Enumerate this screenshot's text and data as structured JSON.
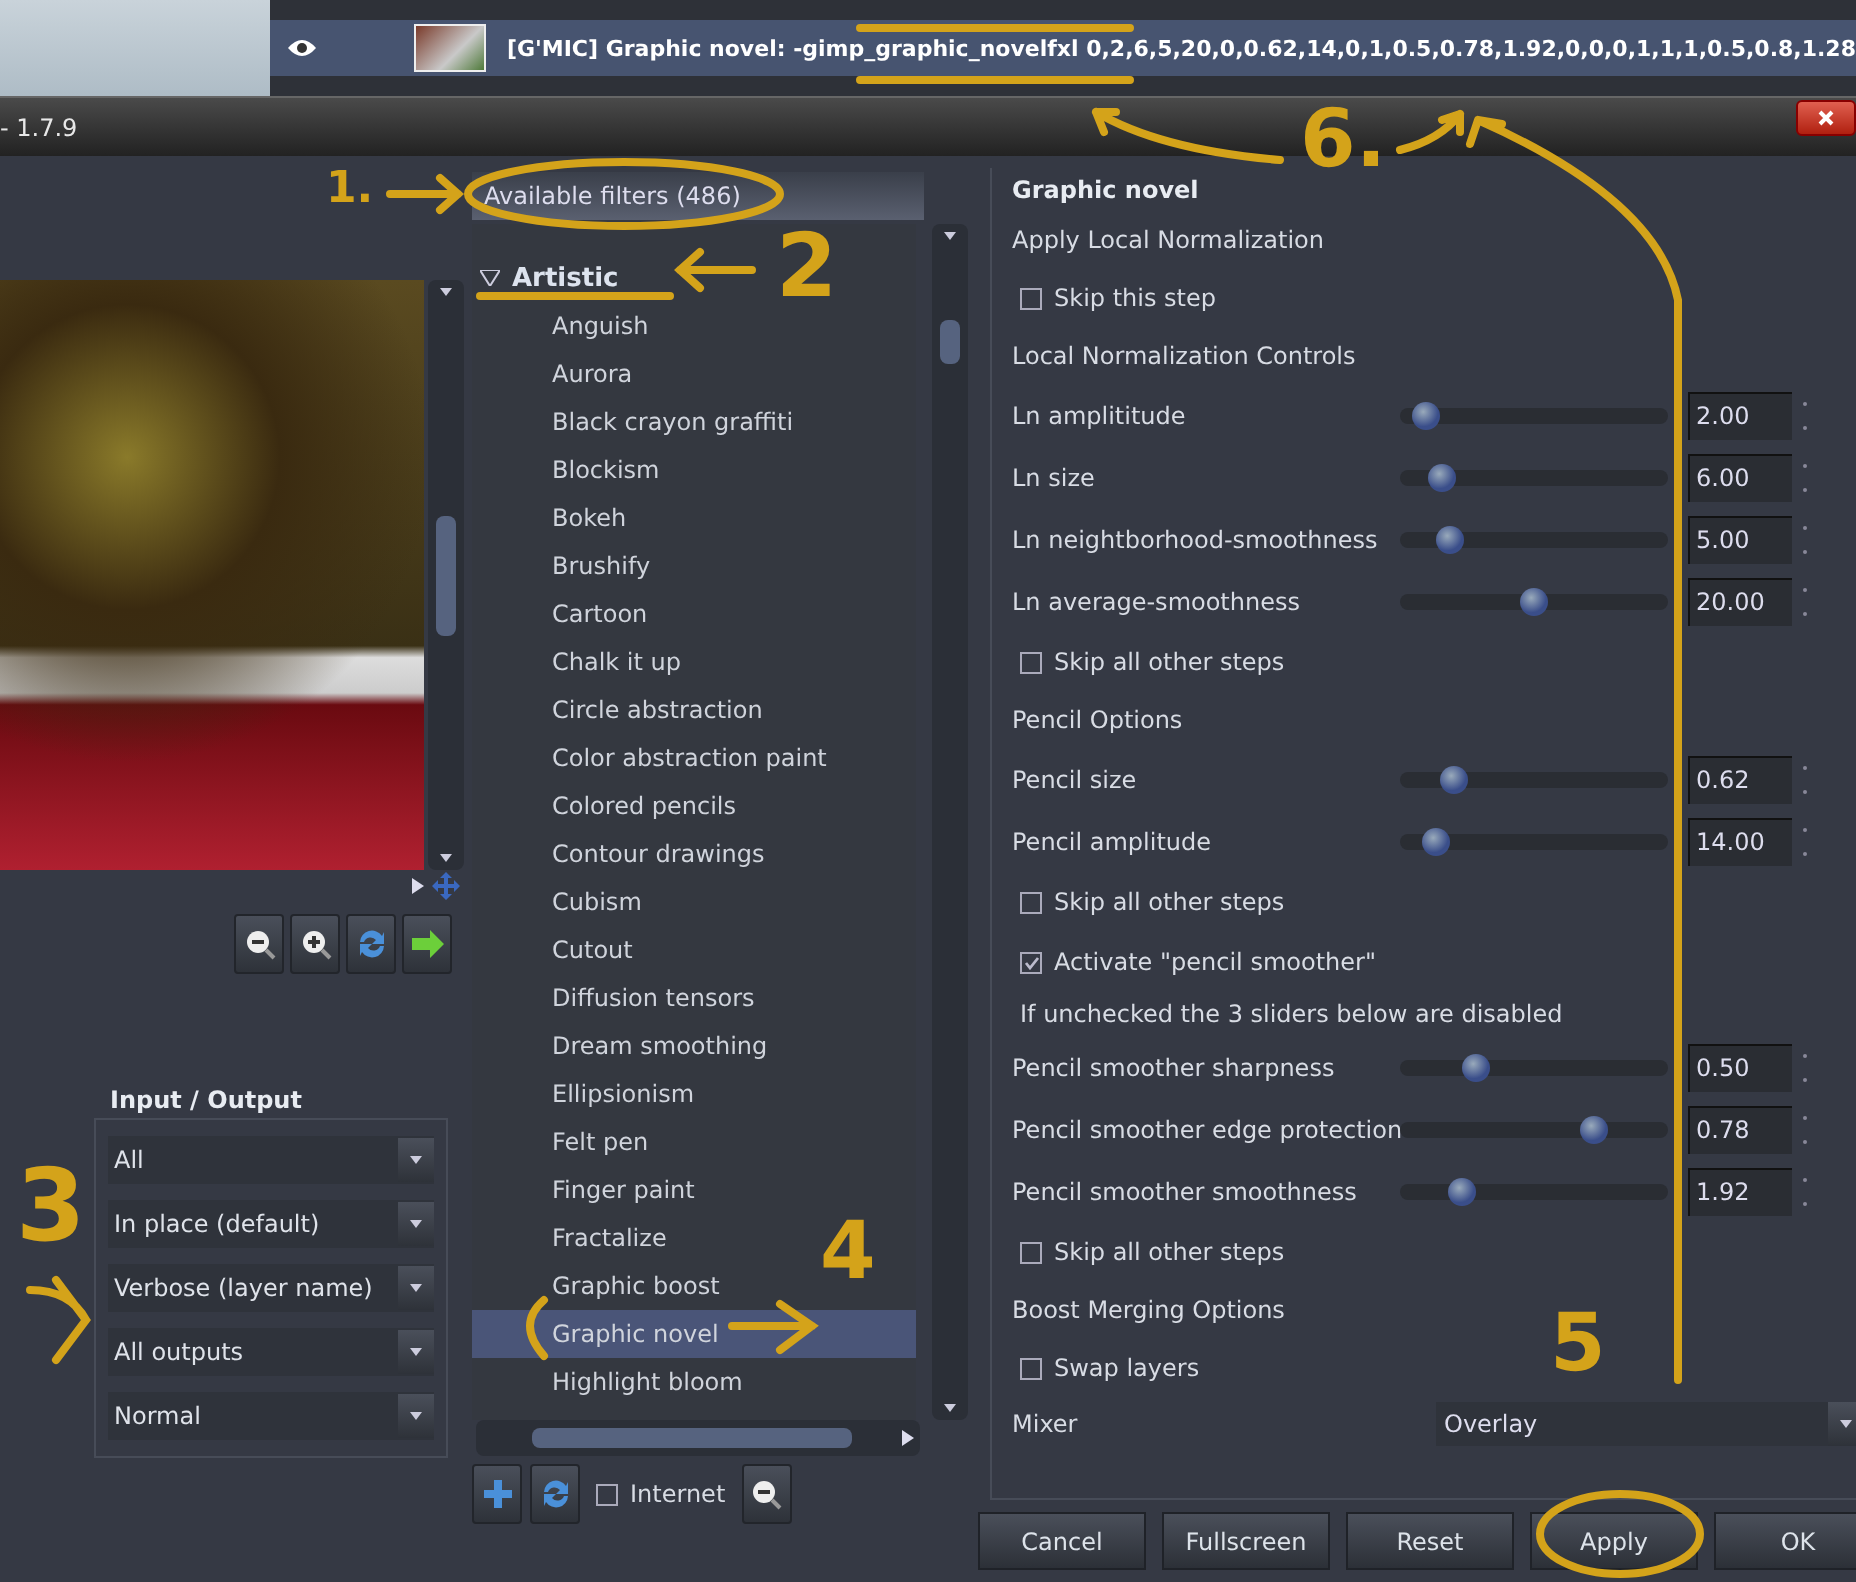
{
  "layer_row": {
    "text": "[G'MIC] Graphic novel: -gimp_graphic_novelfxl 0,2,6,5,20,0,0.62,14,0,1,0.5,0.78,1.92,0,0,0,1,1,1,0.5,0.8,1.28"
  },
  "window": {
    "title": "- 1.7.9"
  },
  "input_output": {
    "title": "Input / Output",
    "selects": [
      "All",
      "In place (default)",
      "Verbose (layer name)",
      "All outputs",
      "Normal"
    ]
  },
  "filters": {
    "header": "Available filters (486)",
    "tree": [
      {
        "label": "Artistic",
        "expanded": true,
        "children": [
          {
            "label": "Anguish",
            "selected": false
          },
          {
            "label": "Aurora",
            "selected": false
          },
          {
            "label": "Black crayon graffiti",
            "selected": false
          },
          {
            "label": "Blockism",
            "selected": false
          },
          {
            "label": "Bokeh",
            "selected": false
          },
          {
            "label": "Brushify",
            "selected": false
          },
          {
            "label": "Cartoon",
            "selected": false
          },
          {
            "label": "Chalk it up",
            "selected": false
          },
          {
            "label": "Circle abstraction",
            "selected": false
          },
          {
            "label": "Color abstraction paint",
            "selected": false
          },
          {
            "label": "Colored pencils",
            "selected": false
          },
          {
            "label": "Contour drawings",
            "selected": false
          },
          {
            "label": "Cubism",
            "selected": false
          },
          {
            "label": "Cutout",
            "selected": false
          },
          {
            "label": "Diffusion tensors",
            "selected": false
          },
          {
            "label": "Dream smoothing",
            "selected": false
          },
          {
            "label": "Ellipsionism",
            "selected": false
          },
          {
            "label": "Felt pen",
            "selected": false
          },
          {
            "label": "Finger paint",
            "selected": false
          },
          {
            "label": "Fractalize",
            "selected": false
          },
          {
            "label": "Graphic boost",
            "selected": false
          },
          {
            "label": "Graphic novel",
            "selected": true
          },
          {
            "label": "Highlight bloom",
            "selected": false
          }
        ]
      }
    ],
    "internet": {
      "label": "Internet",
      "checked": false
    }
  },
  "params": {
    "title": "Graphic novel",
    "rows": [
      {
        "kind": "heading",
        "label": "Apply Local Normalization"
      },
      {
        "kind": "checkbox",
        "label": "Skip this step",
        "checked": false
      },
      {
        "kind": "heading",
        "label": "Local Normalization Controls"
      },
      {
        "kind": "slider",
        "label": "Ln amplititude",
        "level": 0.05,
        "value": "2.00"
      },
      {
        "kind": "slider",
        "label": "Ln size",
        "level": 0.12,
        "value": "6.00"
      },
      {
        "kind": "slider",
        "label": "Ln neightborhood-smoothness",
        "level": 0.15,
        "value": "5.00"
      },
      {
        "kind": "slider",
        "label": "Ln average-smoothness",
        "level": 0.5,
        "value": "20.00"
      },
      {
        "kind": "checkbox",
        "label": "Skip all other steps",
        "checked": false
      },
      {
        "kind": "heading",
        "label": "Pencil Options"
      },
      {
        "kind": "slider",
        "label": "Pencil size",
        "level": 0.17,
        "value": "0.62"
      },
      {
        "kind": "slider",
        "label": "Pencil amplitude",
        "level": 0.09,
        "value": "14.00"
      },
      {
        "kind": "checkbox",
        "label": "Skip all other steps",
        "checked": false
      },
      {
        "kind": "checkbox",
        "label": "Activate \"pencil smoother\"",
        "checked": true
      },
      {
        "kind": "note",
        "label": "If unchecked the 3 sliders below are disabled"
      },
      {
        "kind": "slider",
        "label": "Pencil smoother sharpness",
        "level": 0.26,
        "value": "0.50"
      },
      {
        "kind": "slider",
        "label": "Pencil smoother edge protection",
        "level": 0.75,
        "value": "0.78"
      },
      {
        "kind": "slider",
        "label": "Pencil smoother smoothness",
        "level": 0.2,
        "value": "1.92"
      },
      {
        "kind": "checkbox",
        "label": "Skip all other steps",
        "checked": false
      },
      {
        "kind": "heading",
        "label": "Boost Merging Options"
      },
      {
        "kind": "checkbox",
        "label": "Swap layers",
        "checked": false
      },
      {
        "kind": "select",
        "label": "Mixer",
        "value": "Overlay"
      }
    ]
  },
  "buttons": [
    "Cancel",
    "Fullscreen",
    "Reset",
    "Apply",
    "OK"
  ],
  "annotations": [
    "1.",
    "2",
    "3",
    "4",
    "5",
    "6."
  ]
}
